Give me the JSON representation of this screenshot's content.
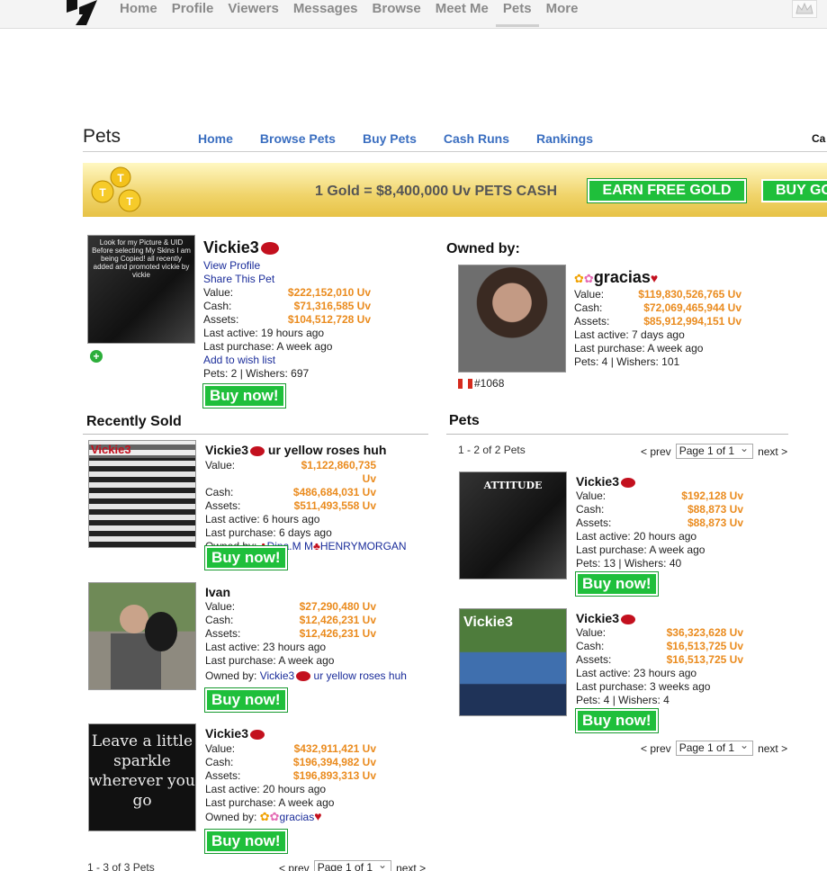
{
  "topnav": {
    "items": [
      "Home",
      "Profile",
      "Viewers",
      "Messages",
      "Browse",
      "Meet Me",
      "Pets",
      "More"
    ],
    "active": "Pets"
  },
  "pets_header": {
    "title": "Pets",
    "links": [
      "Home",
      "Browse Pets",
      "Buy Pets",
      "Cash Runs",
      "Rankings"
    ],
    "right_text": "Ca"
  },
  "banner": {
    "text": "1 Gold = $8,400,000 Uv PETS CASH",
    "earn_label": "EARN FREE GOLD",
    "buy_label": "BUY GO"
  },
  "main_pet": {
    "name": "Vickie3",
    "view_profile": "View Profile",
    "share": "Share This Pet",
    "value_label": "Value:",
    "value": "$222,152,010 Uv",
    "cash_label": "Cash:",
    "cash": "$71,316,585 Uv",
    "assets_label": "Assets:",
    "assets": "$104,512,728 Uv",
    "last_active": "Last active: 19 hours ago",
    "last_purchase": "Last purchase: A week ago",
    "wishlist": "Add to wish list",
    "pets_wishers": "Pets: 2  |  Wishers: 697",
    "buy_label": "Buy now!",
    "photo_text": "Look for my Picture & UID Before selecting My Skins I am being Copied! all recently added and promoted vickie by vickie"
  },
  "owner": {
    "heading": "Owned by:",
    "name": "gracias",
    "value_label": "Value:",
    "value": "$119,830,526,765 Uv",
    "cash_label": "Cash:",
    "cash": "$72,069,465,944 Uv",
    "assets_label": "Assets:",
    "assets": "$85,912,994,151 Uv",
    "last_active": "Last active: 7 days ago",
    "last_purchase": "Last purchase: A week ago",
    "pets_wishers": "Pets: 4  |  Wishers: 101",
    "rank": "#1068"
  },
  "recently_sold": {
    "title": "Recently Sold",
    "items": [
      {
        "name": "Vickie3",
        "name_suffix": "ur yellow roses huh",
        "value": "$1,122,860,735 Uv",
        "cash": "$486,684,031 Uv",
        "assets": "$511,493,558 Uv",
        "last_active": "Last active: 6 hours ago",
        "last_purchase": "Last purchase: 6 days ago",
        "owned_label": "Owned by:",
        "owned_by": "Dina.M M",
        "owned_by_2": "HENRYMORGAN",
        "buy_label": "Buy now!"
      },
      {
        "name": "Ivan",
        "value": "$27,290,480 Uv",
        "cash": "$12,426,231 Uv",
        "assets": "$12,426,231 Uv",
        "last_active": "Last active: 23 hours ago",
        "last_purchase": "Last purchase: A week ago",
        "owned_label": "Owned by:",
        "owned_by": "Vickie3",
        "owned_by_2": "ur yellow roses huh",
        "buy_label": "Buy now!"
      },
      {
        "name": "Vickie3",
        "value": "$432,911,421 Uv",
        "cash": "$196,394,982 Uv",
        "assets": "$196,893,313 Uv",
        "last_active": "Last active: 20 hours ago",
        "last_purchase": "Last purchase: A week ago",
        "owned_label": "Owned by:",
        "owned_by": "gracias",
        "buy_label": "Buy now!"
      }
    ],
    "count": "1 - 3 of 3 Pets",
    "pager": {
      "prev": "< prev",
      "page": "Page 1 of 1",
      "next": "next >"
    }
  },
  "owner_pets": {
    "title": "Pets",
    "count": "1 - 2 of 2 Pets",
    "pager": {
      "prev": "< prev",
      "page": "Page 1 of 1",
      "next": "next >"
    },
    "items": [
      {
        "name": "Vickie3",
        "value": "$192,128 Uv",
        "cash": "$88,873 Uv",
        "assets": "$88,873 Uv",
        "last_active": "Last active: 20 hours ago",
        "last_purchase": "Last purchase: A week ago",
        "pets_wishers": "Pets: 13  |  Wishers: 40",
        "buy_label": "Buy now!"
      },
      {
        "name": "Vickie3",
        "value": "$36,323,628 Uv",
        "cash": "$16,513,725 Uv",
        "assets": "$16,513,725 Uv",
        "last_active": "Last active: 23 hours ago",
        "last_purchase": "Last purchase: 3 weeks ago",
        "pets_wishers": "Pets: 4  |  Wishers: 4",
        "buy_label": "Buy now!"
      }
    ]
  },
  "labels": {
    "value": "Value:",
    "cash": "Cash:",
    "assets": "Assets:"
  },
  "photo_captions": {
    "sold_1": "Vickie3",
    "sold_3": "Leave a little sparkle wherever you go",
    "pet_1": "ATTITUDE",
    "pet_2": "Vickie3"
  },
  "colors": {
    "accent_green": "#1fbf3b",
    "value_orange": "#ea8b1e",
    "link_blue": "#3a6ec0"
  }
}
